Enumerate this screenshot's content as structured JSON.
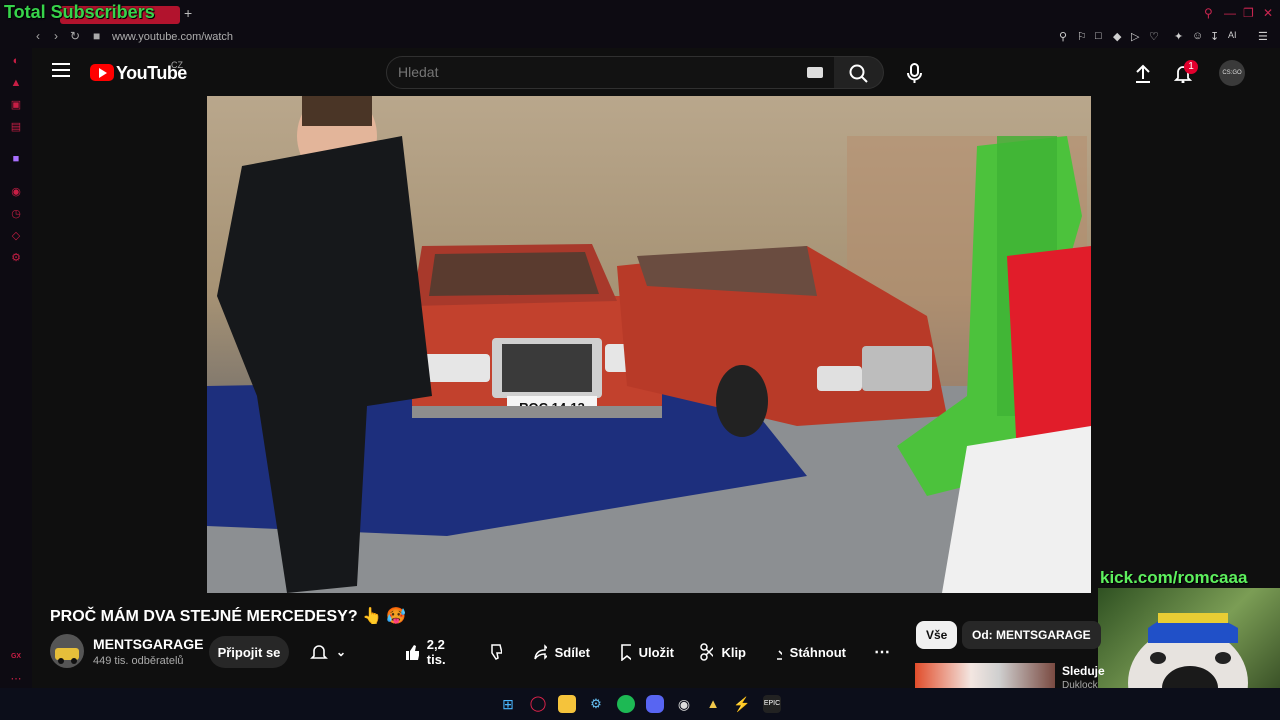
{
  "browser": {
    "overlay_title": "Total Subscribers",
    "url": "www.youtube.com/watch",
    "sidebar_bottom_label": "GX"
  },
  "youtube": {
    "wordmark": "YouTube",
    "country": "CZ",
    "search_placeholder": "Hledat",
    "notification_count": "1",
    "avatar_label": "CS:GO"
  },
  "video": {
    "plate": "ROC 14-13",
    "overlay_link": "kick.com/romcaaa",
    "title": "PROČ MÁM DVA STEJNÉ MERCEDESY? 👆 🥵"
  },
  "channel": {
    "name": "MENTSGARAGE",
    "subscribers": "449 tis. odběratelů"
  },
  "actions": {
    "join": "Připojit se",
    "likes": "2,2 tis.",
    "share": "Sdílet",
    "save": "Uložit",
    "clip": "Klip",
    "download": "Stáhnout"
  },
  "chips": {
    "all": "Vše",
    "from_channel": "Od: MENTSGARAGE"
  },
  "recommendation": {
    "title": "Sleduje",
    "subtitle": "Duklock"
  },
  "colors": {
    "brand_red": "#ff0000",
    "kick_green": "#5ef05e",
    "opera_accent": "#c81e45"
  }
}
